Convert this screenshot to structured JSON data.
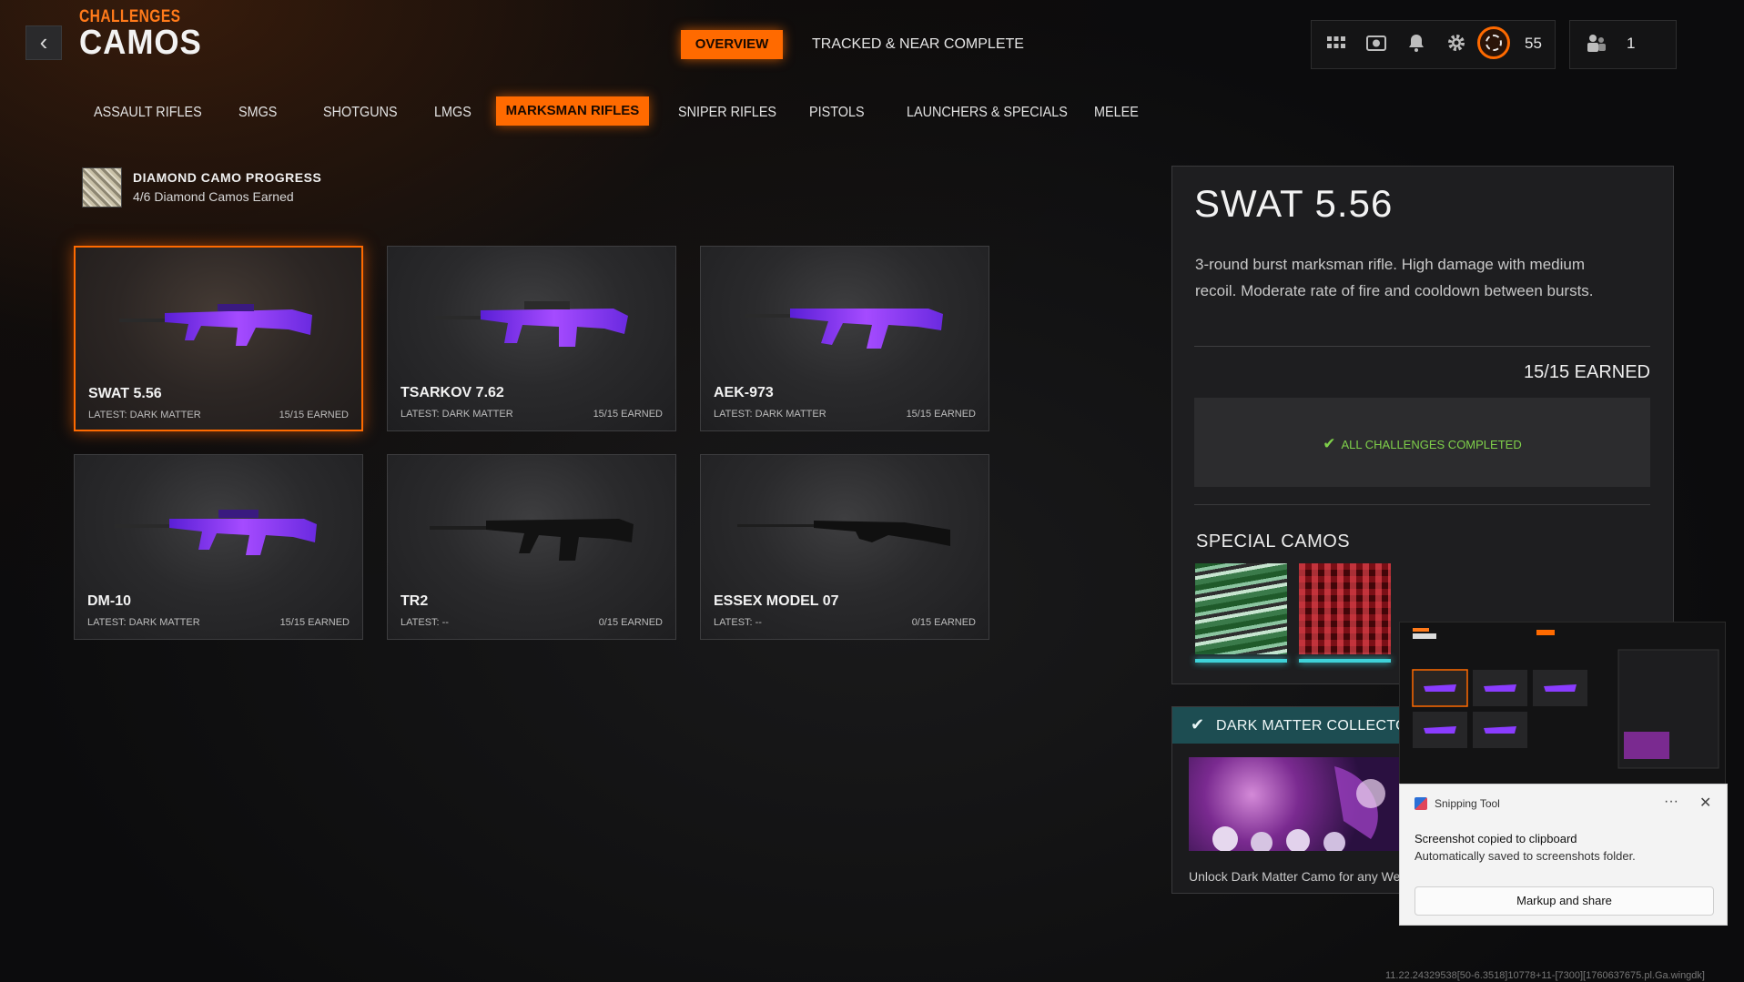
{
  "header": {
    "back_icon": "chevron-left-icon",
    "section": "CHALLENGES",
    "title": "CAMOS",
    "tabs": [
      {
        "label": "OVERVIEW",
        "active": true
      },
      {
        "label": "TRACKED & NEAR COMPLETE",
        "active": false
      }
    ],
    "icons": [
      "grid-icon",
      "camera-icon",
      "bell-icon",
      "gear-icon",
      "prestige-badge-icon"
    ],
    "level": "55",
    "party_count": "1",
    "accent_color": "#ff6a00"
  },
  "categories": [
    {
      "label": "ASSAULT RIFLES",
      "active": false
    },
    {
      "label": "SMGS",
      "active": false
    },
    {
      "label": "SHOTGUNS",
      "active": false
    },
    {
      "label": "LMGS",
      "active": false
    },
    {
      "label": "MARKSMAN RIFLES",
      "active": true
    },
    {
      "label": "SNIPER RIFLES",
      "active": false
    },
    {
      "label": "PISTOLS",
      "active": false
    },
    {
      "label": "LAUNCHERS & SPECIALS",
      "active": false
    },
    {
      "label": "MELEE",
      "active": false
    }
  ],
  "diamond": {
    "title": "DIAMOND CAMO PROGRESS",
    "subtitle": "4/6 Diamond Camos Earned"
  },
  "weapons": [
    {
      "name": "SWAT 5.56",
      "latest": "LATEST: DARK MATTER",
      "earned": "15/15 EARNED",
      "selected": true,
      "camo": "dark-matter"
    },
    {
      "name": "TSARKOV 7.62",
      "latest": "LATEST: DARK MATTER",
      "earned": "15/15 EARNED",
      "selected": false,
      "camo": "dark-matter"
    },
    {
      "name": "AEK-973",
      "latest": "LATEST: DARK MATTER",
      "earned": "15/15 EARNED",
      "selected": false,
      "camo": "dark-matter"
    },
    {
      "name": "DM-10",
      "latest": "LATEST: DARK MATTER",
      "earned": "15/15 EARNED",
      "selected": false,
      "camo": "dark-matter"
    },
    {
      "name": "TR2",
      "latest": "LATEST: --",
      "earned": "0/15 EARNED",
      "selected": false,
      "camo": "none"
    },
    {
      "name": "ESSEX MODEL 07",
      "latest": "LATEST: --",
      "earned": "0/15 EARNED",
      "selected": false,
      "camo": "none"
    }
  ],
  "detail": {
    "title": "SWAT 5.56",
    "description": "3-round burst marksman rifle.  High damage with medium recoil. Moderate rate of fire and cooldown between bursts.",
    "earned": "15/15 EARNED",
    "completed_label": "ALL CHALLENGES COMPLETED",
    "completed_color": "#7fd04a",
    "special_title": "SPECIAL CAMOS"
  },
  "dark_matter": {
    "title": "DARK MATTER COLLECTOR",
    "text": "Unlock Dark Matter Camo for any Wea"
  },
  "toast": {
    "app_name": "Snipping Tool",
    "more": "···",
    "close": "✕",
    "title": "Screenshot copied to clipboard",
    "body": "Automatically saved to screenshots folder.",
    "button": "Markup and share"
  },
  "footer": "11.22.24329538[50-6.3518]10778+11-[7300][1760637675.pl.Ga.wingdk]"
}
